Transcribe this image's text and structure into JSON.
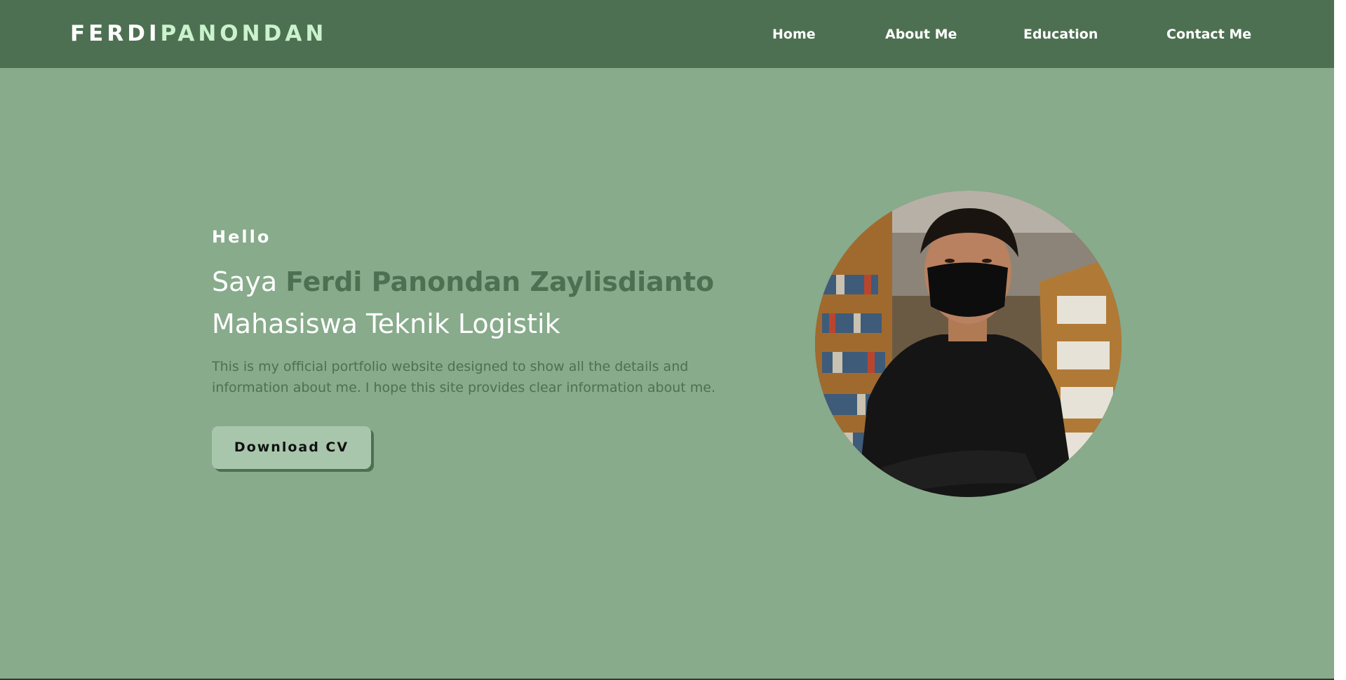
{
  "header": {
    "logo_first": "FERDI",
    "logo_last": "PANONDAN",
    "nav": [
      {
        "label": "Home"
      },
      {
        "label": "About Me"
      },
      {
        "label": "Education"
      },
      {
        "label": "Contact Me"
      }
    ]
  },
  "hero": {
    "greeting": "Hello",
    "intro_prefix": "Saya ",
    "name": "Ferdi Panondan Zaylisdianto",
    "role": "Mahasiswa Teknik Logistik",
    "description": "This is my official portfolio website designed to show all the details and information about me. I hope this site provides clear information about me.",
    "cta_label": "Download CV"
  },
  "colors": {
    "header_bg": "#4e7052",
    "page_bg": "#87ab8b",
    "accent_text": "#4e7052",
    "logo_accent": "#c8f3cc",
    "button_bg": "#a8c6ab"
  },
  "icons": {
    "profile_photo": "profile-photo"
  }
}
